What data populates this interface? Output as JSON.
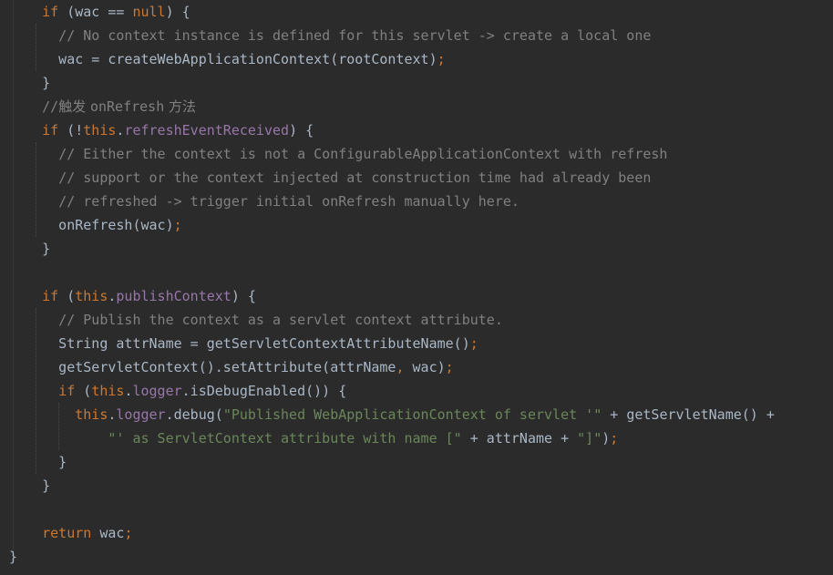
{
  "code": {
    "lines": [
      [
        {
          "t": "    "
        },
        {
          "t": "if",
          "c": "kw"
        },
        {
          "t": " (wac == "
        },
        {
          "t": "null",
          "c": "kw"
        },
        {
          "t": ") {"
        }
      ],
      [
        {
          "t": "      "
        },
        {
          "t": "// No context instance is defined for this servlet -> create a local one",
          "c": "cmt"
        }
      ],
      [
        {
          "t": "      wac = createWebApplicationContext(rootContext)"
        },
        {
          "t": ";",
          "c": "kw"
        }
      ],
      [
        {
          "t": "    }"
        }
      ],
      [
        {
          "t": "    //",
          "c": "cmt"
        },
        {
          "t": "触发 ",
          "c": "cmt cjk"
        },
        {
          "t": "onRefresh",
          "c": "cmt"
        },
        {
          "t": " 方法",
          "c": "cmt cjk"
        }
      ],
      [
        {
          "t": "    "
        },
        {
          "t": "if",
          "c": "kw"
        },
        {
          "t": " (!"
        },
        {
          "t": "this",
          "c": "kw"
        },
        {
          "t": "."
        },
        {
          "t": "refreshEventReceived",
          "c": "fld"
        },
        {
          "t": ") {"
        }
      ],
      [
        {
          "t": "      "
        },
        {
          "t": "// Either the context is not a ConfigurableApplicationContext with refresh",
          "c": "cmt"
        }
      ],
      [
        {
          "t": "      "
        },
        {
          "t": "// support or the context injected at construction time had already been",
          "c": "cmt"
        }
      ],
      [
        {
          "t": "      "
        },
        {
          "t": "// refreshed -> trigger initial onRefresh manually here.",
          "c": "cmt"
        }
      ],
      [
        {
          "t": "      onRefresh(wac)"
        },
        {
          "t": ";",
          "c": "kw"
        }
      ],
      [
        {
          "t": "    }"
        }
      ],
      [],
      [
        {
          "t": "    "
        },
        {
          "t": "if",
          "c": "kw"
        },
        {
          "t": " ("
        },
        {
          "t": "this",
          "c": "kw"
        },
        {
          "t": "."
        },
        {
          "t": "publishContext",
          "c": "fld"
        },
        {
          "t": ") {"
        }
      ],
      [
        {
          "t": "      "
        },
        {
          "t": "// Publish the context as a servlet context attribute.",
          "c": "cmt"
        }
      ],
      [
        {
          "t": "      String attrName = getServletContextAttributeName()"
        },
        {
          "t": ";",
          "c": "kw"
        }
      ],
      [
        {
          "t": "      getServletContext().setAttribute(attrName"
        },
        {
          "t": ",",
          "c": "kw"
        },
        {
          "t": " wac)"
        },
        {
          "t": ";",
          "c": "kw"
        }
      ],
      [
        {
          "t": "      "
        },
        {
          "t": "if",
          "c": "kw"
        },
        {
          "t": " ("
        },
        {
          "t": "this",
          "c": "kw"
        },
        {
          "t": "."
        },
        {
          "t": "logger",
          "c": "fld"
        },
        {
          "t": ".isDebugEnabled()) {"
        }
      ],
      [
        {
          "t": "        "
        },
        {
          "t": "this",
          "c": "kw"
        },
        {
          "t": "."
        },
        {
          "t": "logger",
          "c": "fld"
        },
        {
          "t": ".debug("
        },
        {
          "t": "\"Published WebApplicationContext of servlet '\"",
          "c": "str"
        },
        {
          "t": " + getServletName() +"
        }
      ],
      [
        {
          "t": "            "
        },
        {
          "t": "\"' as ServletContext attribute with name [\"",
          "c": "str"
        },
        {
          "t": " + attrName + "
        },
        {
          "t": "\"]\"",
          "c": "str"
        },
        {
          "t": ")"
        },
        {
          "t": ";",
          "c": "kw"
        }
      ],
      [
        {
          "t": "      }"
        }
      ],
      [
        {
          "t": "    }"
        }
      ],
      [],
      [
        {
          "t": "    "
        },
        {
          "t": "return",
          "c": "kw"
        },
        {
          "t": " wac"
        },
        {
          "t": ";",
          "c": "kw"
        }
      ],
      [
        {
          "t": "}"
        }
      ]
    ]
  }
}
